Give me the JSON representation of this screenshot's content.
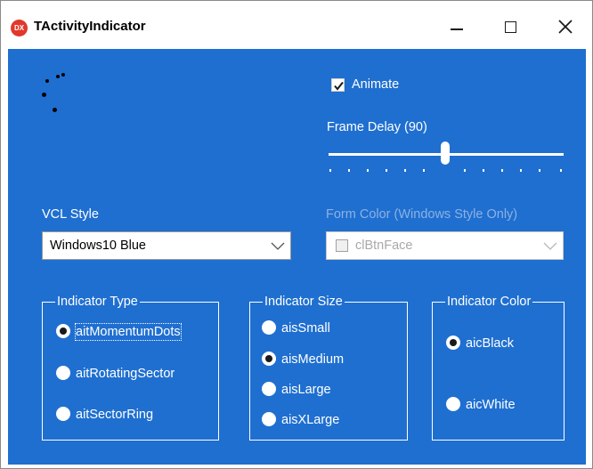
{
  "window": {
    "title": "TActivityIndicator",
    "icon_text": "DX",
    "icon_color": "#e1382c",
    "client_bg": "#1f6fd0"
  },
  "titlebar_buttons": [
    "minimize-icon",
    "maximize-icon",
    "close-icon"
  ],
  "animate": {
    "label": "Animate",
    "checked": true
  },
  "frame_delay": {
    "label": "Frame Delay (90)",
    "value": 90,
    "position_fraction": 0.5,
    "tick_count": 12
  },
  "vcl_style": {
    "label": "VCL Style",
    "value": "Windows10 Blue"
  },
  "form_color": {
    "label": "Form Color (Windows Style Only)",
    "value": "clBtnFace",
    "enabled": false
  },
  "indicator_type": {
    "title": "Indicator Type",
    "options": [
      "aitMomentumDots",
      "aitRotatingSector",
      "aitSectorRing"
    ],
    "selected": "aitMomentumDots"
  },
  "indicator_size": {
    "title": "Indicator Size",
    "options": [
      "aisSmall",
      "aisMedium",
      "aisLarge",
      "aisXLarge"
    ],
    "selected": "aisMedium"
  },
  "indicator_color": {
    "title": "Indicator Color",
    "options": [
      "aicBlack",
      "aicWhite"
    ],
    "selected": "aicBlack"
  }
}
